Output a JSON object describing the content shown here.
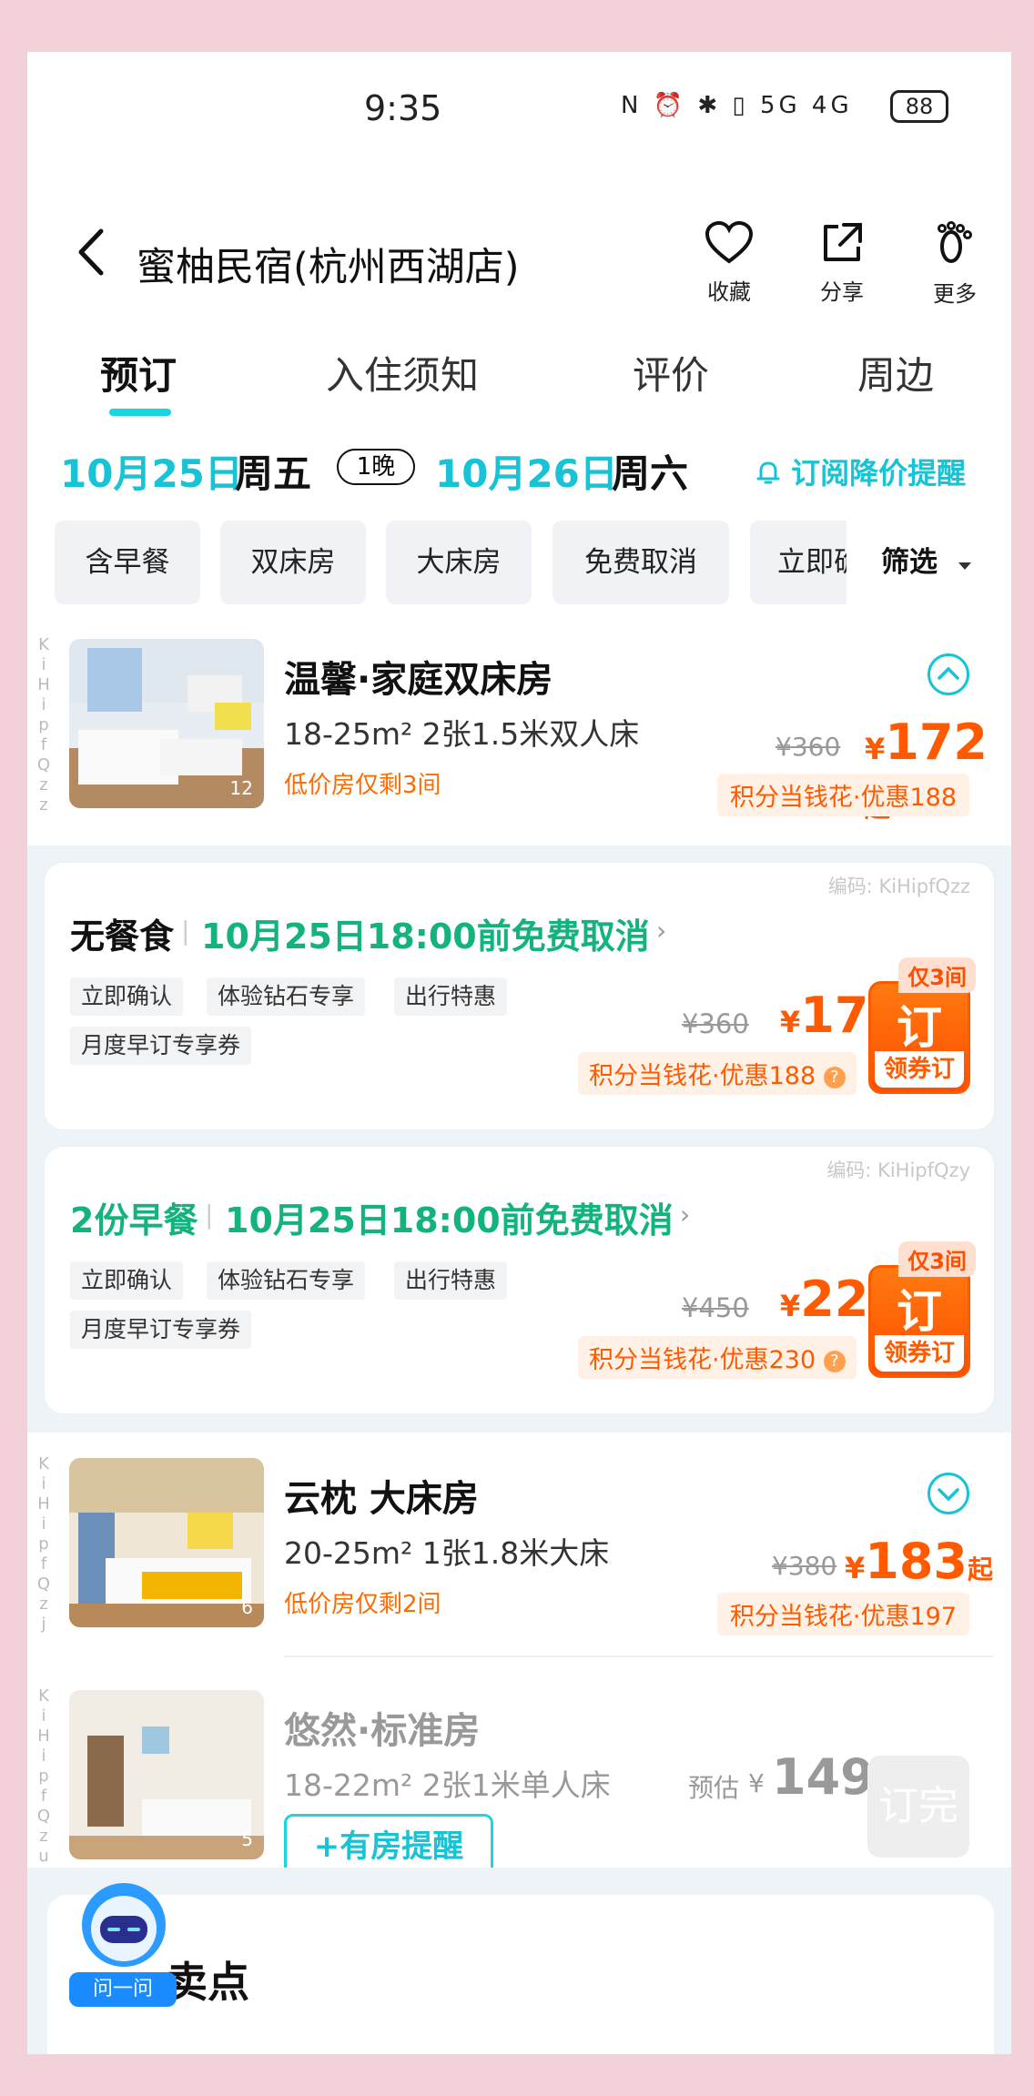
{
  "status": {
    "time": "9:35",
    "icons": "N ⏰ ✱ ▯ 5G 4G",
    "battery": "88"
  },
  "header": {
    "title": "蜜柚民宿(杭州西湖店)",
    "actions": [
      {
        "icon": "heart-icon",
        "label": "收藏"
      },
      {
        "icon": "share-icon",
        "label": "分享"
      },
      {
        "icon": "footprint-icon",
        "label": "更多"
      }
    ]
  },
  "tabs": [
    "预订",
    "入住须知",
    "评价",
    "周边"
  ],
  "dates": {
    "checkin": "10月25日",
    "checkin_day": "周五",
    "nights": "1晚",
    "checkout": "10月26日",
    "checkout_day": "周六",
    "alert": "订阅降价提醒"
  },
  "filters": [
    "含早餐",
    "双床房",
    "大床房",
    "免费取消",
    "立即确"
  ],
  "filter_button": "筛选",
  "rooms": [
    {
      "name": "温馨·家庭双床房",
      "spec": "18-25m² 2张1.5米双人床",
      "low": "低价房仅剩3间",
      "photos": "12",
      "orig": "¥360",
      "price": "172",
      "yen": "¥",
      "suffix": "起",
      "points": "积分当钱花·优惠188",
      "side": "K\ni\nH\ni\np\nf\nQ\nz\nz"
    },
    {
      "name": "云枕  大床房",
      "spec": "20-25m² 1张1.8米大床",
      "low": "低价房仅剩2间",
      "photos": "6",
      "orig": "¥380",
      "price": "183",
      "yen": "¥",
      "suffix": "起",
      "points": "积分当钱花·优惠197",
      "side": "K\ni\nH\ni\np\nf\nQ\nz\nj"
    },
    {
      "name": "悠然·标准房",
      "spec": "18-22m² 2张1米单人床",
      "photos": "5",
      "est_label": "预估",
      "yen": "¥",
      "price": "149",
      "soldout": "订完",
      "remind": "+有房提醒",
      "side": "K\ni\nH\ni\np\nf\nQ\nz\nu"
    }
  ],
  "rates": [
    {
      "code": "编码: KiHipfQzz",
      "meal": "无餐食",
      "cancel": "10月25日18:00前免费取消",
      "tags": [
        "立即确认",
        "体验钻石专享",
        "出行特惠",
        "月度早订专享券"
      ],
      "orig": "¥360",
      "yen": "¥",
      "price": "172",
      "points": "积分当钱花·优惠188",
      "only": "仅3间",
      "book": "订",
      "coupon": "领券订"
    },
    {
      "code": "编码: KiHipfQzy",
      "meal": "2份早餐",
      "cancel": "10月25日18:00前免费取消",
      "tags": [
        "立即确认",
        "体验钻石专享",
        "出行特惠",
        "月度早订专享券"
      ],
      "orig": "¥450",
      "yen": "¥",
      "price": "220",
      "points": "积分当钱花·优惠230",
      "only": "仅3间",
      "book": "订",
      "coupon": "领券订"
    }
  ],
  "section_title": "卖点",
  "assistant_label": "问一问",
  "colors": {
    "accent": "#17c3d4",
    "price": "#ff5a00",
    "green": "#14b37d"
  }
}
